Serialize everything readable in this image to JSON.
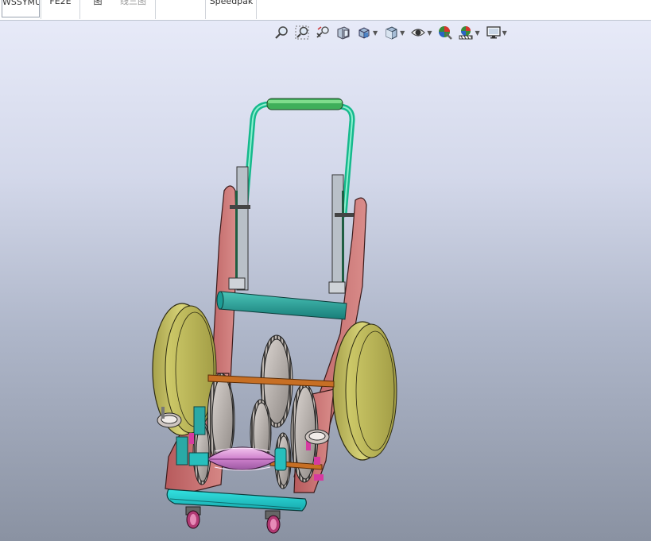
{
  "tabs": [
    {
      "label": "WSSYMU",
      "selected": true
    },
    {
      "label": "FE2E"
    },
    {
      "label": "图"
    },
    {
      "label": "线三图"
    },
    {
      "label": ""
    },
    {
      "label": "Speedpak"
    }
  ],
  "toolbar": {
    "items": [
      {
        "icon": "zoom-to-fit-icon"
      },
      {
        "icon": "zoom-to-area-icon"
      },
      {
        "icon": "previous-view-icon"
      },
      {
        "icon": "section-view-icon"
      },
      {
        "icon": "view-orientation-icon",
        "dropdown": true
      },
      {
        "icon": "display-style-icon",
        "dropdown": true
      },
      {
        "icon": "hide-show-items-icon",
        "dropdown": true
      },
      {
        "icon": "edit-appearance-icon"
      },
      {
        "icon": "apply-scene-icon",
        "dropdown": true
      },
      {
        "icon": "view-settings-icon",
        "dropdown": true
      }
    ]
  }
}
